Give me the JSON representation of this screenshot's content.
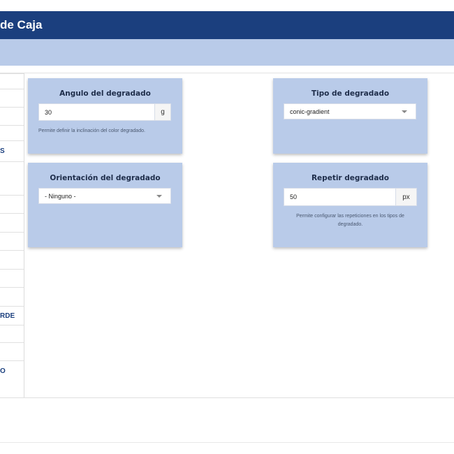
{
  "header": {
    "title": "de Caja"
  },
  "sidebar": {
    "items": [
      {
        "label": ""
      },
      {
        "label": ""
      },
      {
        "label": ""
      },
      {
        "label": ""
      },
      {
        "label": "S"
      },
      {
        "label": ""
      },
      {
        "label": ""
      },
      {
        "label": ""
      },
      {
        "label": ""
      },
      {
        "label": ""
      },
      {
        "label": ""
      },
      {
        "label": ""
      },
      {
        "label": "RDE"
      },
      {
        "label": ""
      },
      {
        "label": ""
      },
      {
        "label": "O"
      }
    ]
  },
  "cards": {
    "angle": {
      "title": "Angulo del degradado",
      "value": "30",
      "unit": "g",
      "help": "Permite definir la inclinación del color degradado."
    },
    "type": {
      "title": "Tipo de degradado",
      "selected": "conic-gradient"
    },
    "orientation": {
      "title": "Orientación del degradado",
      "selected": "- Ninguno -"
    },
    "repeat": {
      "title": "Repetir degradado",
      "value": "50",
      "unit": "px",
      "help_line1": "Permite configurar las repeticiones en los tipos de",
      "help_line2": "degradado."
    }
  },
  "colors": {
    "header_bg": "#1b3f7e",
    "subbar_bg": "#b9cbe9",
    "card_bg": "#b9cbe9",
    "accent_text": "#1b3f7e"
  }
}
